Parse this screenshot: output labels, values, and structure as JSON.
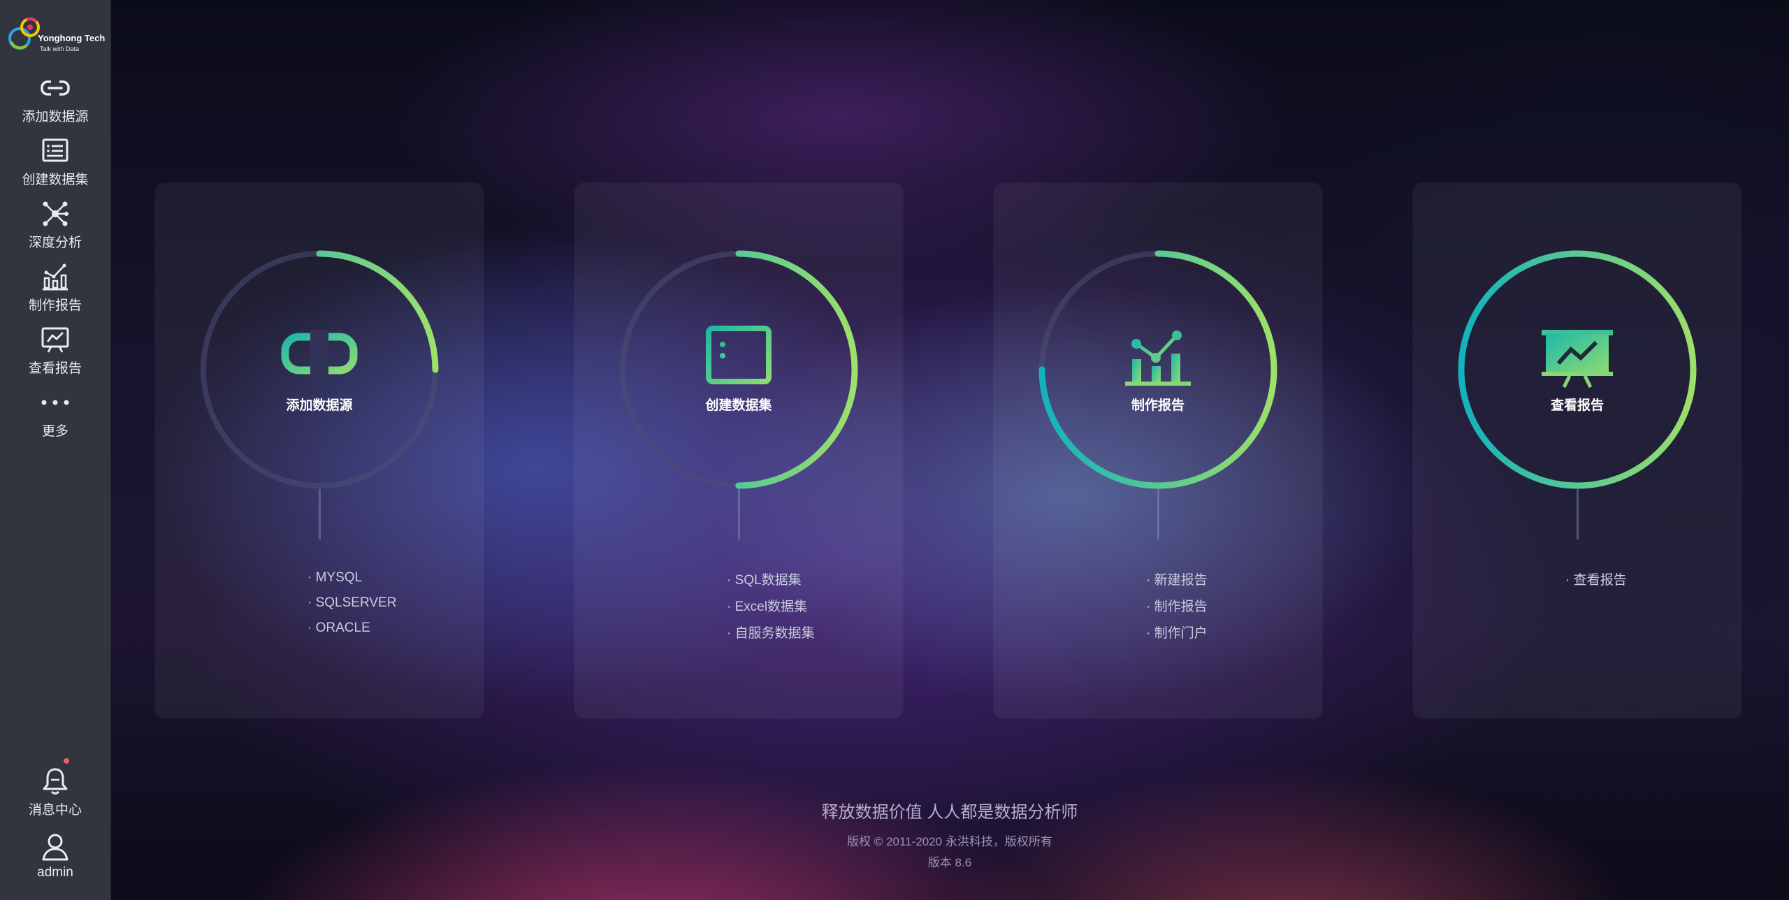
{
  "app": {
    "logo_name": "Yonghong Tech",
    "logo_tagline": "Talk with Data"
  },
  "sidebar": {
    "items": [
      {
        "label": "添加数据源",
        "icon": "link-icon"
      },
      {
        "label": "创建数据集",
        "icon": "dataset-list-icon"
      },
      {
        "label": "深度分析",
        "icon": "network-nodes-icon"
      },
      {
        "label": "制作报告",
        "icon": "bar-chart-icon"
      },
      {
        "label": "查看报告",
        "icon": "presentation-chart-icon"
      },
      {
        "label": "更多",
        "icon": "more-dots-icon"
      }
    ],
    "bottom": [
      {
        "label": "消息中心",
        "icon": "bell-icon"
      },
      {
        "label": "admin",
        "icon": "user-icon"
      }
    ]
  },
  "cards": [
    {
      "title": "添加数据源",
      "icon": "link-icon",
      "progress": 0.25,
      "items": [
        "· MYSQL",
        "· SQLSERVER",
        "· ORACLE"
      ]
    },
    {
      "title": "创建数据集",
      "icon": "dataset-list-icon",
      "progress": 0.5,
      "items": [
        "· SQL数据集",
        "· Excel数据集",
        "· 自服务数据集"
      ]
    },
    {
      "title": "制作报告",
      "icon": "bar-chart-icon",
      "progress": 0.75,
      "items": [
        "· 新建报告",
        "· 制作报告",
        "· 制作门户"
      ]
    },
    {
      "title": "查看报告",
      "icon": "presentation-chart-icon",
      "progress": 1.0,
      "items": [
        "· 查看报告"
      ]
    }
  ],
  "footer": {
    "slogan": "释放数据价值 人人都是数据分析师",
    "copyright": "版权 © 2011-2020 永洪科技，版权所有",
    "version": "版本 8.6"
  },
  "colors": {
    "sidebar_bg": "#31353f",
    "ring_start": "#12b2bd",
    "ring_end": "#9ee06a",
    "ring_track": "#4a4f74"
  }
}
